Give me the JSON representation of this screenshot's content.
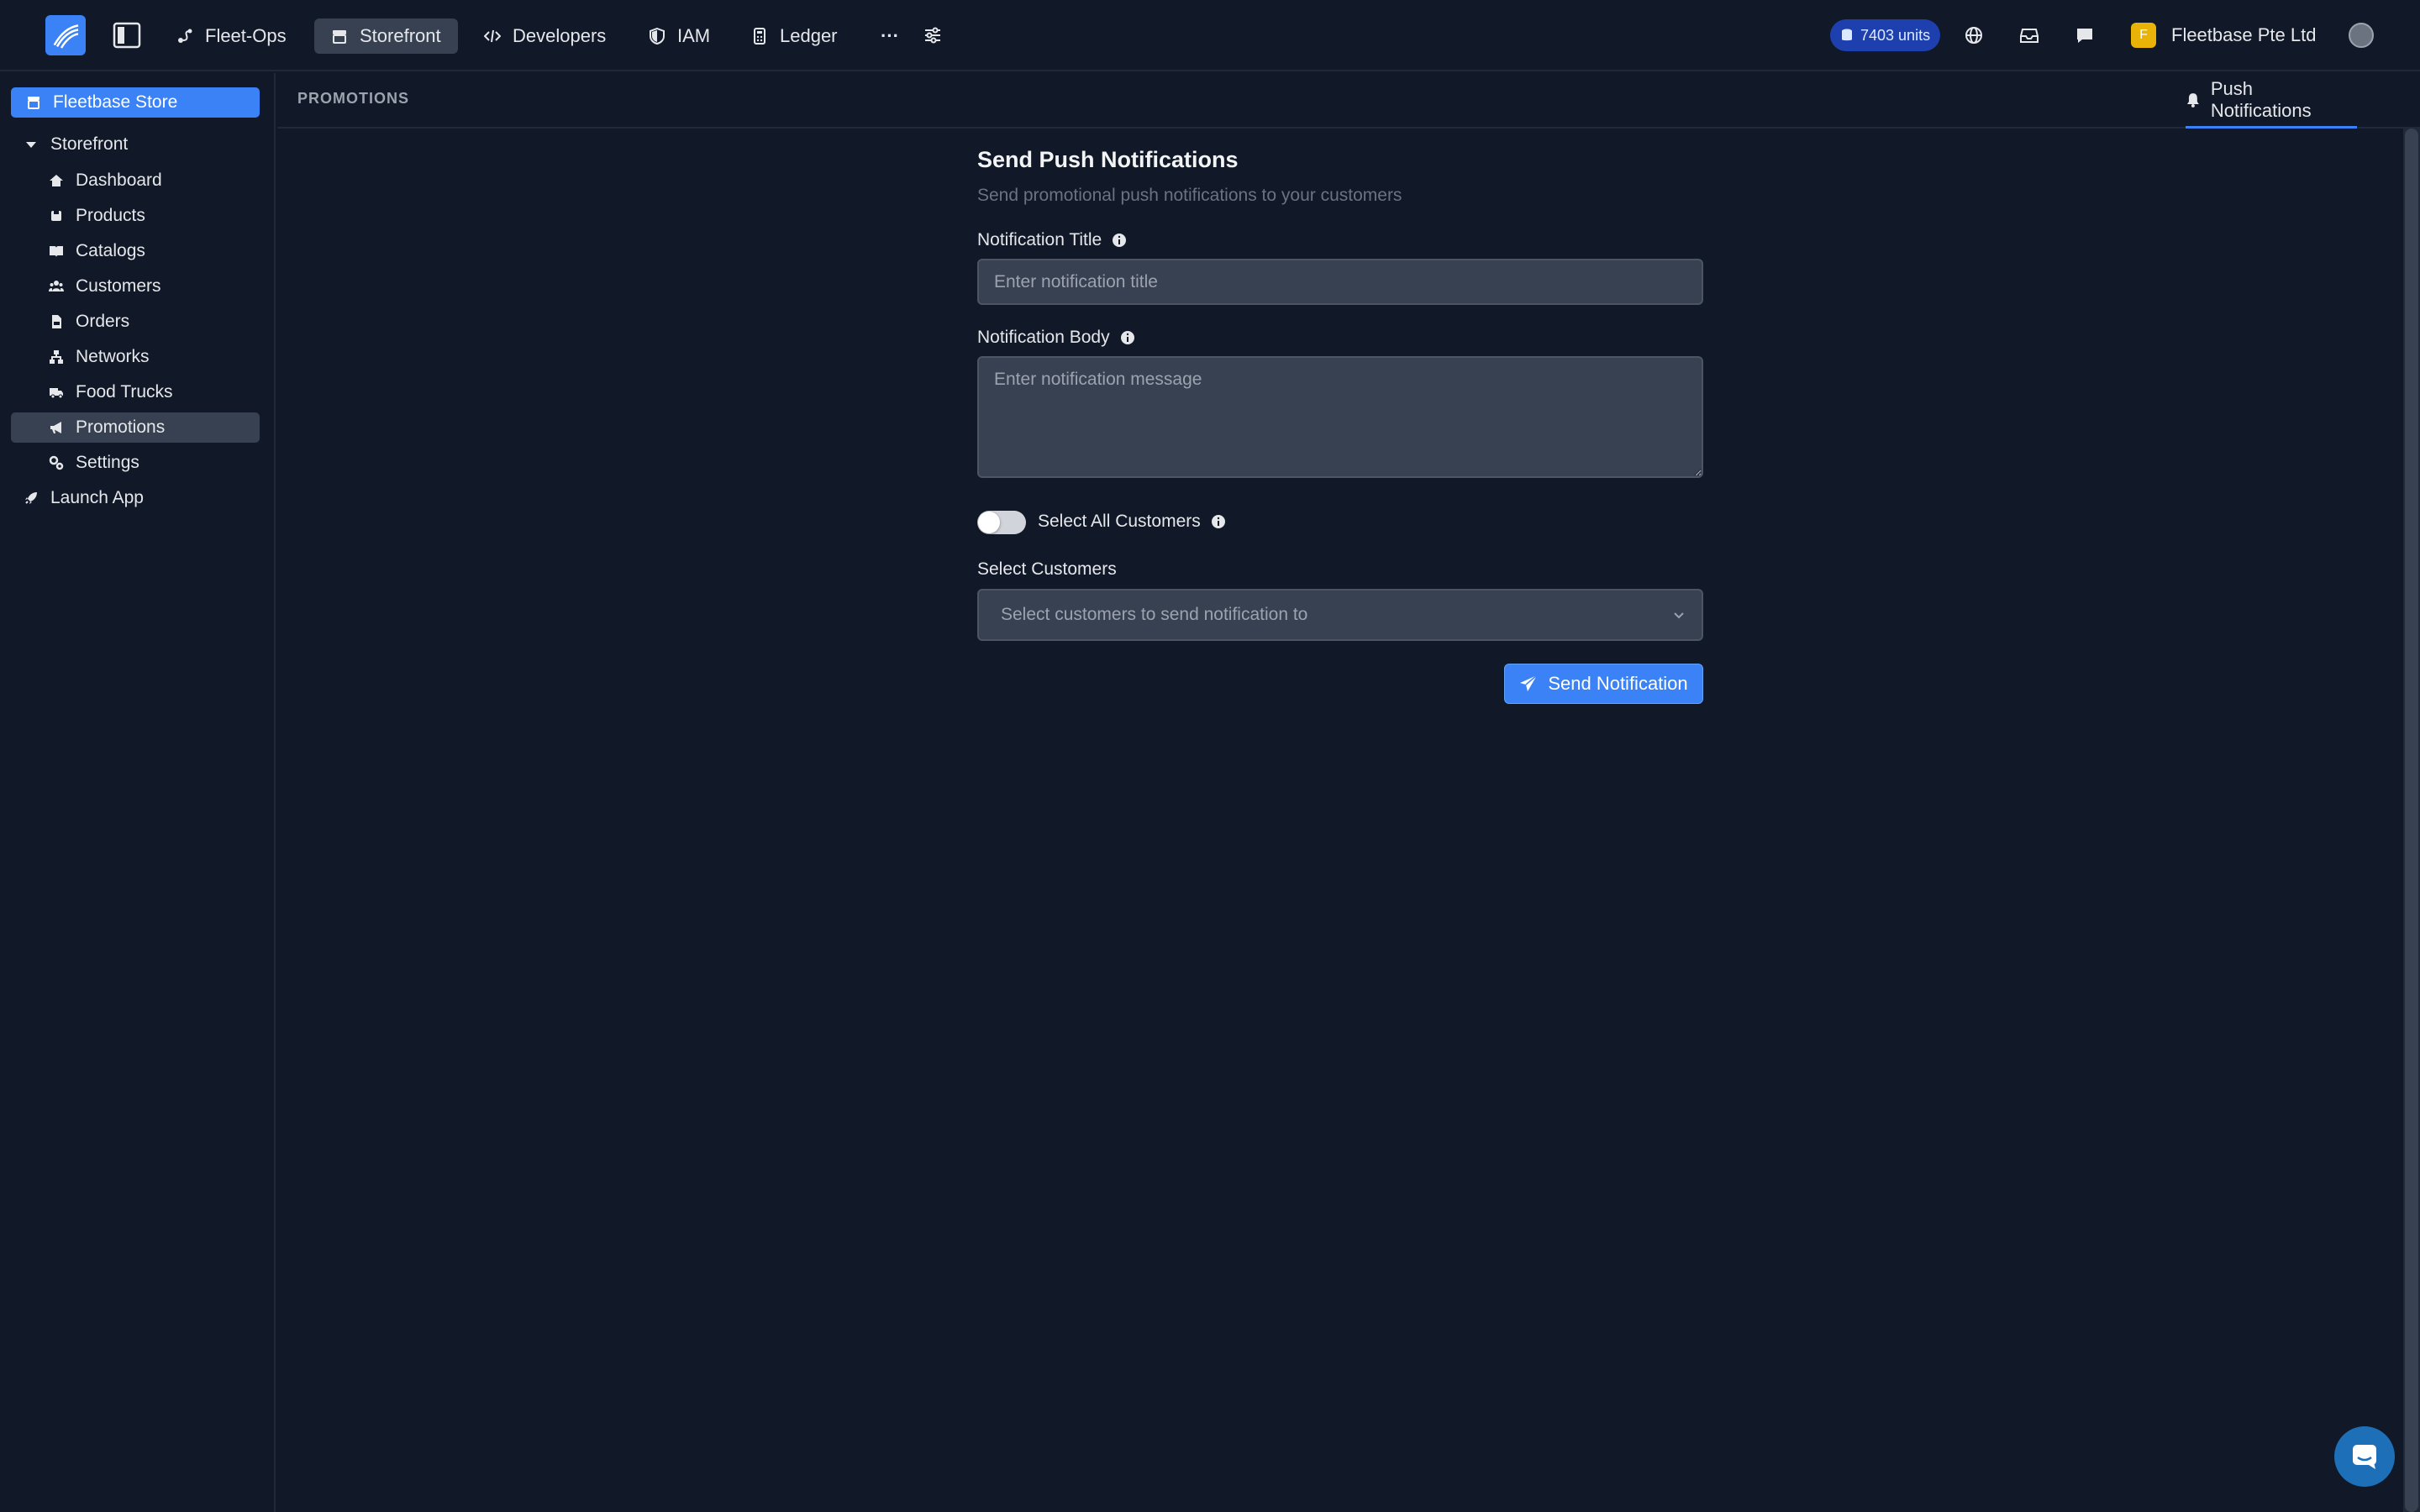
{
  "topbar": {
    "nav": [
      {
        "label": "Fleet-Ops"
      },
      {
        "label": "Storefront"
      },
      {
        "label": "Developers"
      },
      {
        "label": "IAM"
      },
      {
        "label": "Ledger"
      }
    ],
    "more_label": "···",
    "units": "7403 units",
    "org_initial": "F",
    "org_name": "Fleetbase Pte Ltd"
  },
  "sidebar": {
    "store_label": "Fleetbase Store",
    "section_label": "Storefront",
    "items": [
      {
        "label": "Dashboard"
      },
      {
        "label": "Products"
      },
      {
        "label": "Catalogs"
      },
      {
        "label": "Customers"
      },
      {
        "label": "Orders"
      },
      {
        "label": "Networks"
      },
      {
        "label": "Food Trucks"
      },
      {
        "label": "Promotions"
      },
      {
        "label": "Settings"
      }
    ],
    "launch_label": "Launch App"
  },
  "header": {
    "breadcrumb": "PROMOTIONS",
    "tab_label": "Push Notifications"
  },
  "form": {
    "title": "Send Push Notifications",
    "subtitle": "Send promotional push notifications to your customers",
    "title_label": "Notification Title",
    "title_placeholder": "Enter notification title",
    "body_label": "Notification Body",
    "body_placeholder": "Enter notification message",
    "select_all_label": "Select All Customers",
    "select_all_on": false,
    "customers_label": "Select Customers",
    "customers_placeholder": "Select customers to send notification to",
    "send_label": "Send Notification"
  },
  "colors": {
    "accent": "#3b82f6",
    "background": "#111827",
    "input_bg": "#374151",
    "units_badge": "#1e40af",
    "org_badge": "#eab308"
  }
}
